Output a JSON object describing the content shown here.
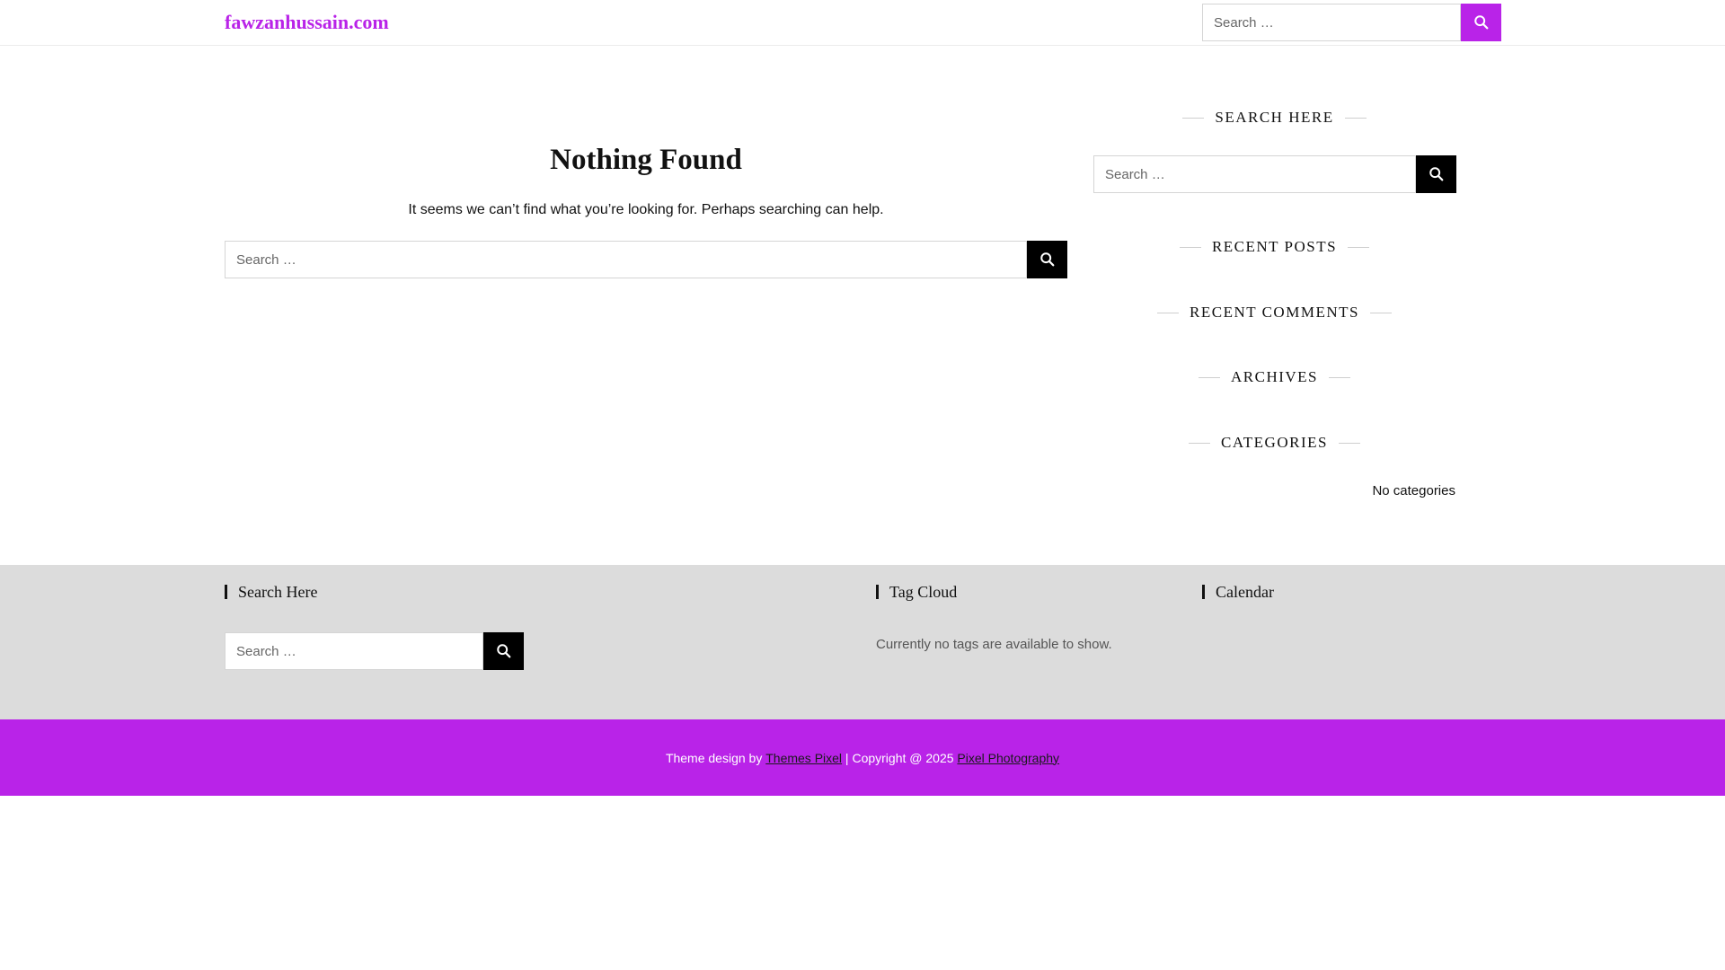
{
  "header": {
    "site_title": "fawzanhussain.com",
    "search_placeholder": "Search …"
  },
  "main": {
    "title": "Nothing Found",
    "message": "It seems we can’t find what you’re looking for. Perhaps searching can help.",
    "search_placeholder": "Search …"
  },
  "sidebar": {
    "search_title": "SEARCH HERE",
    "search_placeholder": "Search …",
    "recent_posts_title": "RECENT POSTS",
    "recent_comments_title": "RECENT COMMENTS",
    "archives_title": "ARCHIVES",
    "categories_title": "CATEGORIES",
    "categories_empty": "No categories"
  },
  "footer_widgets": {
    "search_title": "Search Here",
    "search_placeholder": "Search …",
    "tag_cloud_title": "Tag Cloud",
    "tag_cloud_text": "Currently no tags are available to show.",
    "calendar_title": "Calendar"
  },
  "bottom_bar": {
    "prefix": "Theme design by ",
    "themes_link": "Themes Pixel",
    "middle": " | Copyright @ 2025 ",
    "photo_link": "Pixel Photography"
  },
  "colors": {
    "accent": "#b923e8",
    "footer_bg": "#dcdcdc",
    "button_dark": "#000000"
  },
  "icons": {
    "search": "search-icon"
  }
}
